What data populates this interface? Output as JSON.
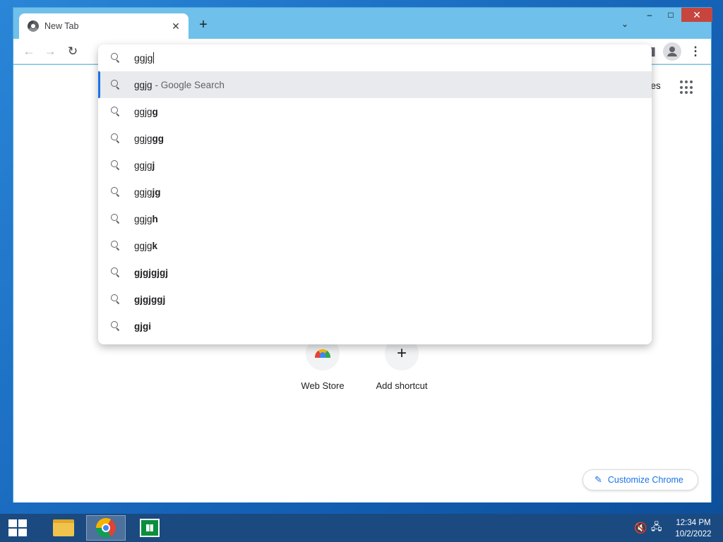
{
  "browser": {
    "tab": {
      "title": "New Tab",
      "close_glyph": "✕"
    },
    "new_tab_glyph": "+",
    "tab_search_glyph": "⌄",
    "window_controls": {
      "minimize": "‒",
      "maximize": "□",
      "close": "✕"
    },
    "toolbar": {
      "back": "←",
      "forward": "→",
      "reload": "↻",
      "side_panel": "◨",
      "menu": "⋮"
    }
  },
  "omnibox": {
    "input_value": "ggjg",
    "suggestions": [
      {
        "plain": "ggjg",
        "bold": "",
        "suffix": "- Google Search"
      },
      {
        "plain": "ggjg",
        "bold": "g",
        "suffix": ""
      },
      {
        "plain": "ggjg",
        "bold": "gg",
        "suffix": ""
      },
      {
        "plain": "ggjg",
        "bold": "j",
        "suffix": ""
      },
      {
        "plain": "ggjg",
        "bold": "jg",
        "suffix": ""
      },
      {
        "plain": "ggjg",
        "bold": "h",
        "suffix": ""
      },
      {
        "plain": "ggjg",
        "bold": "k",
        "suffix": ""
      },
      {
        "plain": "",
        "bold": "gjgjgjgj",
        "suffix": ""
      },
      {
        "plain": "",
        "bold": "gjgjggj",
        "suffix": ""
      },
      {
        "plain": "",
        "bold": "gjgi",
        "suffix": ""
      }
    ]
  },
  "newtab": {
    "images_link": "nages",
    "shortcuts": [
      {
        "label": "Web Store"
      },
      {
        "label": "Add shortcut",
        "glyph": "+"
      }
    ],
    "customize": {
      "label": "Customize Chrome",
      "glyph": "✎"
    }
  },
  "taskbar": {
    "clock": {
      "time": "12:34 PM",
      "date": "10/2/2022"
    },
    "tray_sound_glyph": "🔇",
    "tray_network_glyph": "🖧"
  },
  "colors": {
    "accent": "#1a73e8",
    "close_button": "#c7453f",
    "selection": "#e8eaed"
  }
}
